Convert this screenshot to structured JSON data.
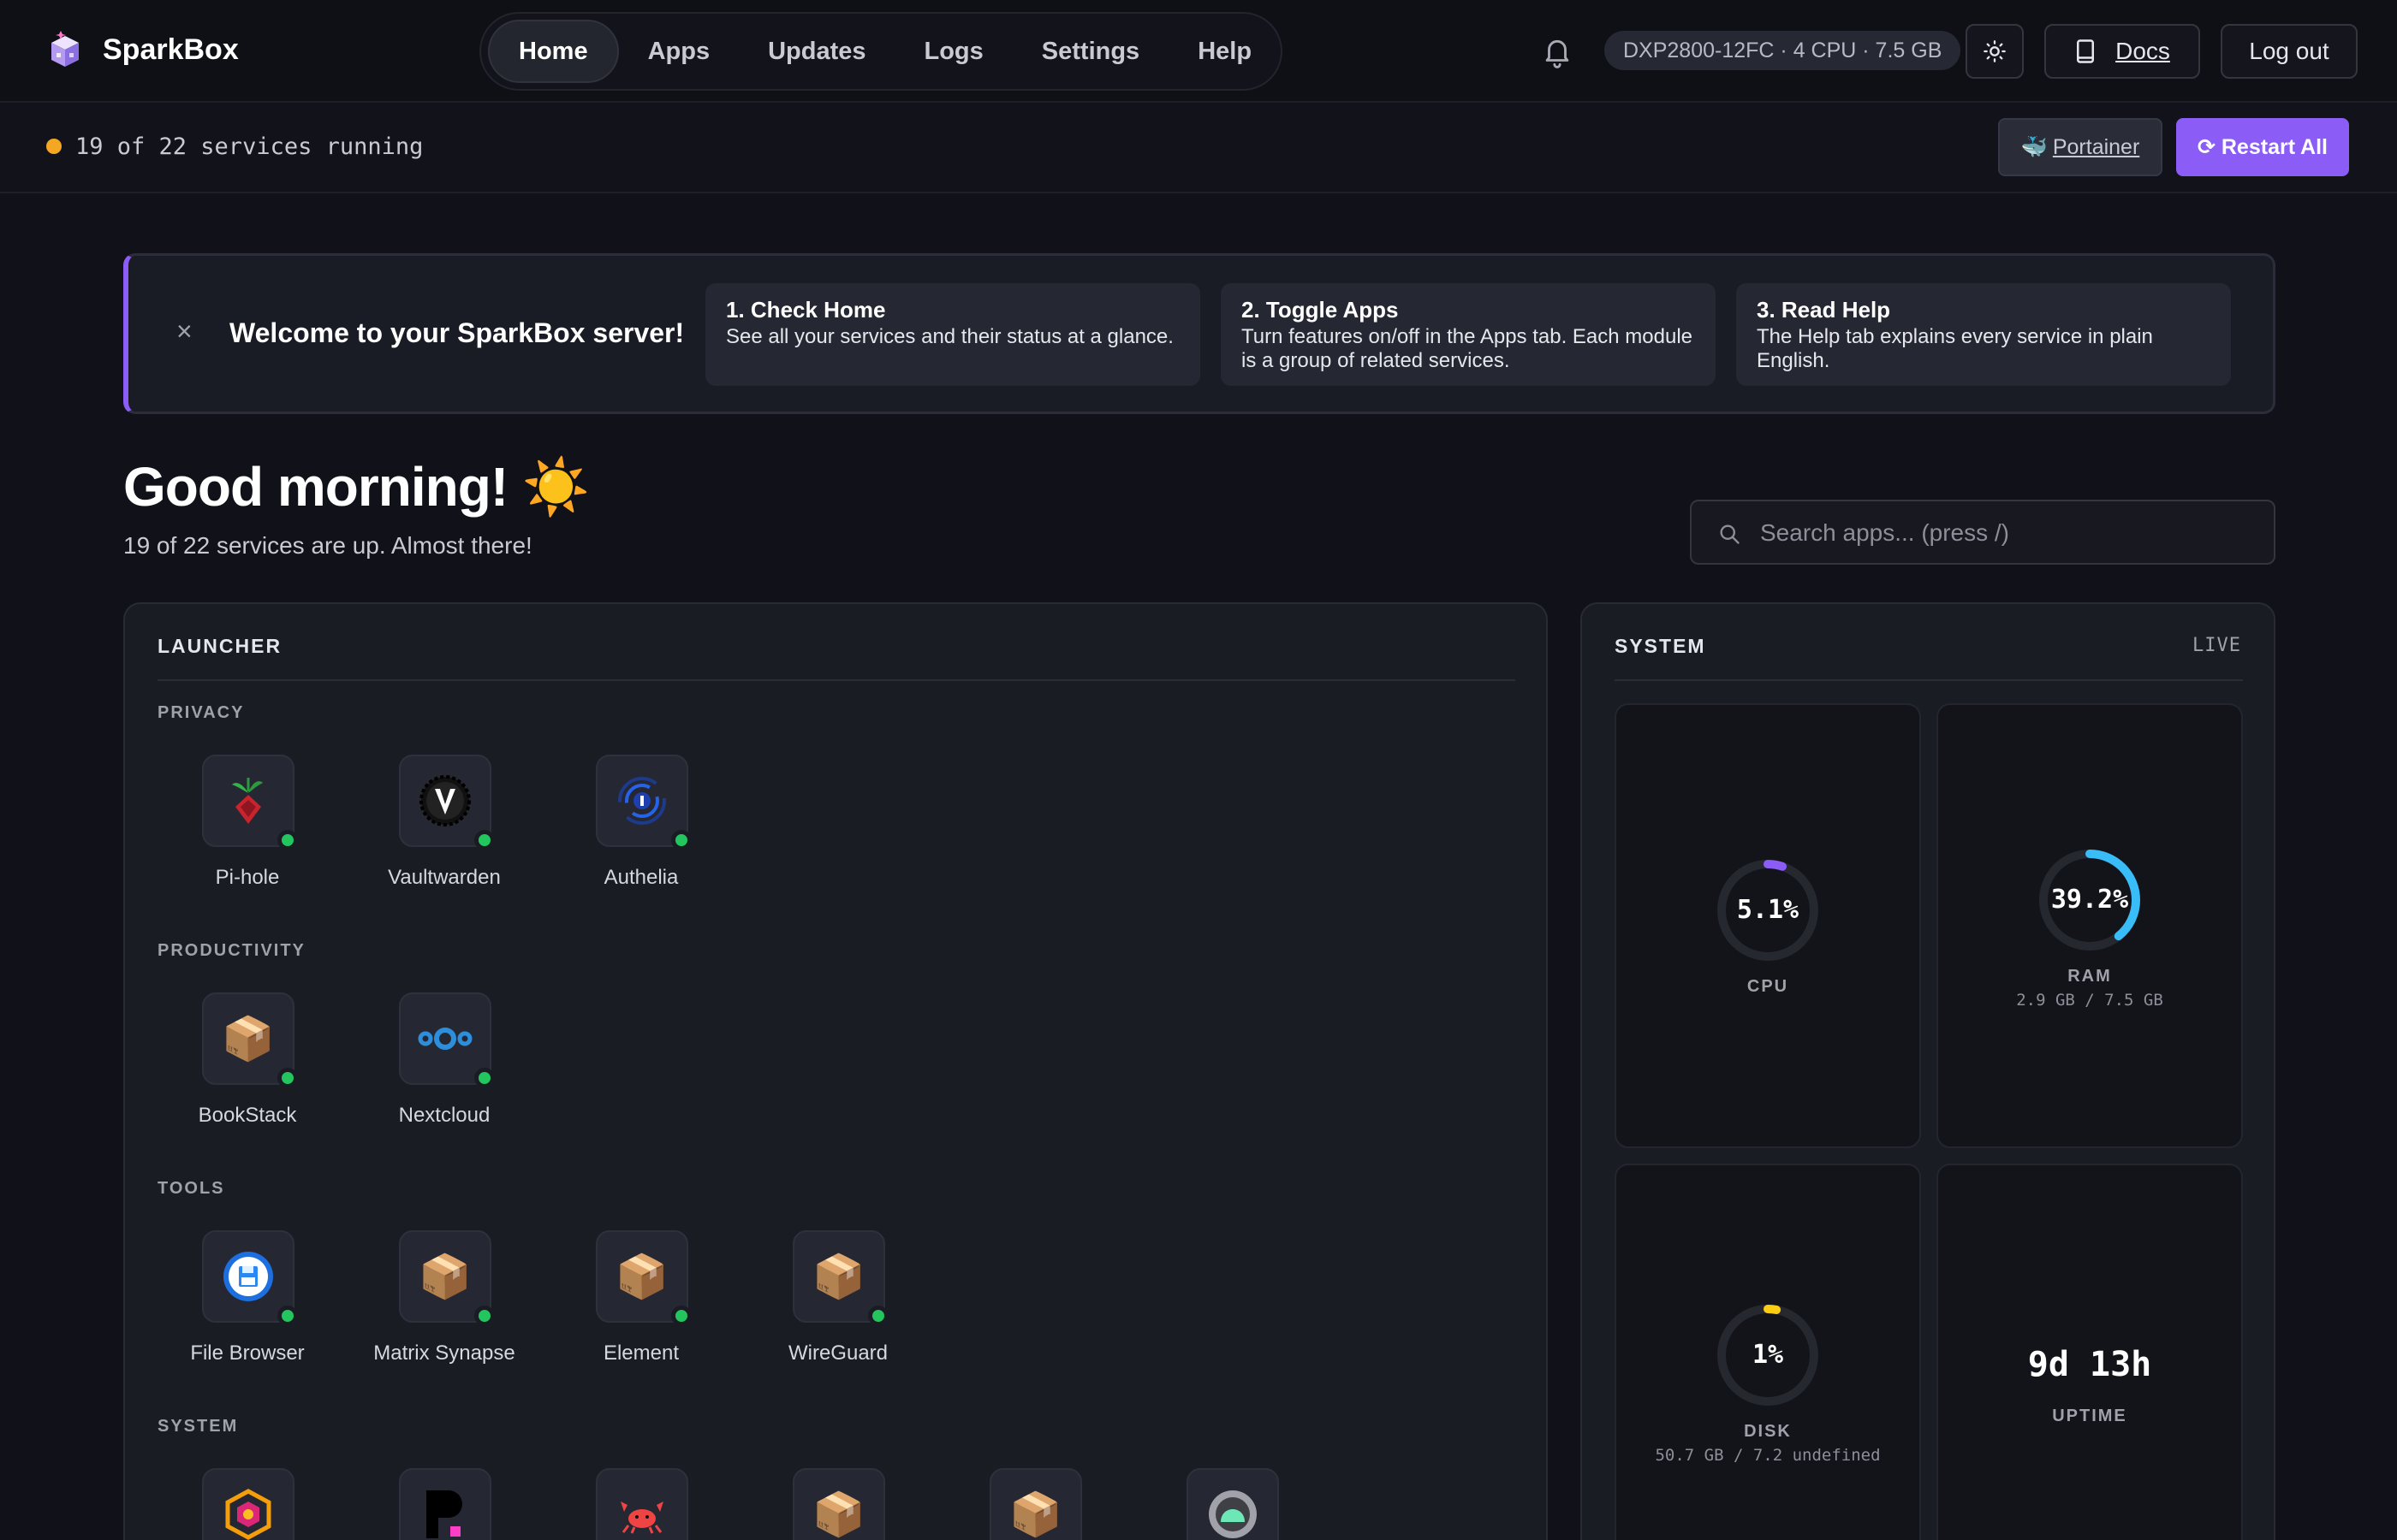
{
  "app": {
    "name": "SparkBox"
  },
  "nav": {
    "items": [
      {
        "label": "Home",
        "active": true
      },
      {
        "label": "Apps"
      },
      {
        "label": "Updates"
      },
      {
        "label": "Logs"
      },
      {
        "label": "Settings"
      },
      {
        "label": "Help"
      }
    ]
  },
  "host": {
    "info": "DXP2800-12FC · 4 CPU · 7.5 GB"
  },
  "header_actions": {
    "docs_label": "Docs",
    "logout_label": "Log out",
    "theme_icon": "sun-icon",
    "notifications_icon": "bell-icon"
  },
  "status": {
    "text": "19 of 22 services running",
    "dot_color": "#f5a623"
  },
  "actions": {
    "portainer_label": "Portainer",
    "portainer_icon": "🐳",
    "restart_label": "⟳ Restart All",
    "accent": "#8b5cf6"
  },
  "welcome": {
    "close": "×",
    "title": "Welcome to your SparkBox server!",
    "steps": [
      {
        "title": "1. Check Home",
        "desc": "See all your services and their status at a glance."
      },
      {
        "title": "2. Toggle Apps",
        "desc": "Turn features on/off in the Apps tab. Each module is a group of related services."
      },
      {
        "title": "3. Read Help",
        "desc": "The Help tab explains every service in plain English."
      }
    ]
  },
  "greeting": {
    "title": "Good morning! ☀️",
    "subtitle": "19 of 22 services are up. Almost there!"
  },
  "search": {
    "placeholder": "Search apps... (press /)",
    "value": ""
  },
  "launcher": {
    "title": "LAUNCHER",
    "categories": [
      {
        "name": "PRIVACY",
        "apps": [
          {
            "name": "Pi-hole",
            "icon": "pihole-icon",
            "status": "up"
          },
          {
            "name": "Vaultwarden",
            "icon": "vaultwarden-icon",
            "status": "up"
          },
          {
            "name": "Authelia",
            "icon": "authelia-icon",
            "status": "up"
          }
        ]
      },
      {
        "name": "PRODUCTIVITY",
        "apps": [
          {
            "name": "BookStack",
            "icon": "package-icon",
            "status": "up"
          },
          {
            "name": "Nextcloud",
            "icon": "nextcloud-icon",
            "status": "up"
          }
        ]
      },
      {
        "name": "TOOLS",
        "apps": [
          {
            "name": "File Browser",
            "icon": "filebrowser-icon",
            "status": "up"
          },
          {
            "name": "Matrix Synapse",
            "icon": "package-icon",
            "status": "up"
          },
          {
            "name": "Element",
            "icon": "package-icon",
            "status": "up"
          },
          {
            "name": "WireGuard",
            "icon": "package-icon",
            "status": "up"
          }
        ]
      },
      {
        "name": "SYSTEM",
        "apps": [
          {
            "name": "",
            "icon": "hexagon-icon"
          },
          {
            "name": "",
            "icon": "p-letter-icon"
          },
          {
            "name": "",
            "icon": "crab-icon"
          },
          {
            "name": "",
            "icon": "package-icon"
          },
          {
            "name": "",
            "icon": "package-icon"
          },
          {
            "name": "",
            "icon": "green-blob-icon"
          }
        ]
      }
    ]
  },
  "system": {
    "title": "SYSTEM",
    "live_label": "LIVE",
    "cpu": {
      "value": "5.1%",
      "percent": 5.1,
      "label": "CPU",
      "color": "#8b5cf6"
    },
    "ram": {
      "value": "39.2%",
      "percent": 39.2,
      "label": "RAM",
      "detail": "2.9 GB / 7.5 GB",
      "color": "#38bdf8"
    },
    "disk": {
      "value": "1%",
      "percent": 1,
      "label": "DISK",
      "detail": "50.7 GB / 7.2 undefined",
      "color": "#facc15"
    },
    "uptime": {
      "value": "9d 13h",
      "label": "UPTIME"
    }
  }
}
